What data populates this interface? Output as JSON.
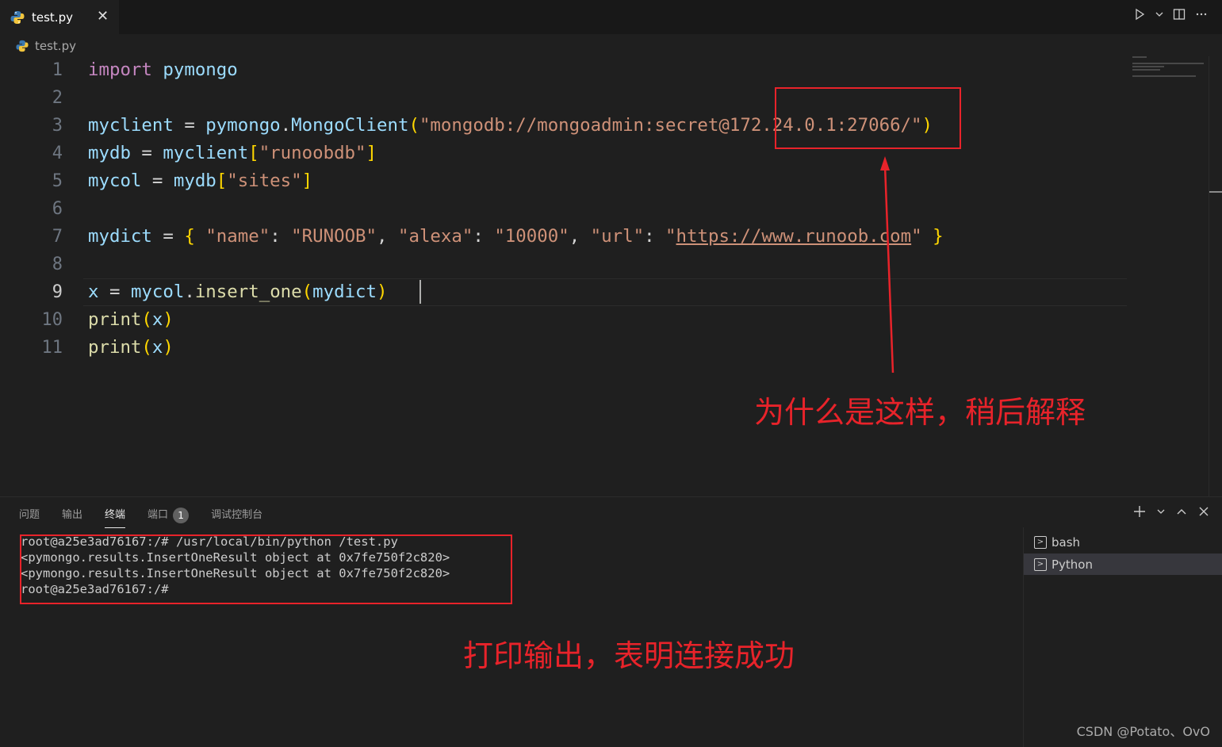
{
  "tab": {
    "label": "test.py",
    "close": "✕"
  },
  "breadcrumb": {
    "file": "test.py"
  },
  "editor": {
    "line_numbers": [
      "1",
      "2",
      "3",
      "4",
      "5",
      "6",
      "7",
      "8",
      "9",
      "10",
      "11"
    ],
    "lines": {
      "l1_kw": "import",
      "l1_mod": "pymongo",
      "l3_var": "myclient",
      "l3_eq": " = ",
      "l3_mod": "pymongo",
      "l3_dot": ".",
      "l3_fn": "MongoClient",
      "l3_open": "(",
      "l3_str": "\"mongodb://mongoadmin:secret@172.24.0.1:27066/\"",
      "l3_close": ")",
      "l4_var": "mydb",
      "l4_eq": " = ",
      "l4_obj": "myclient",
      "l4_open": "[",
      "l4_str": "\"runoobdb\"",
      "l4_close": "]",
      "l5_var": "mycol",
      "l5_eq": " = ",
      "l5_obj": "mydb",
      "l5_open": "[",
      "l5_str": "\"sites\"",
      "l5_close": "]",
      "l7_var": "mydict",
      "l7_eq": " = ",
      "l7_open": "{",
      "l7_k1": "\"name\"",
      "l7_c1": ": ",
      "l7_v1": "\"RUNOOB\"",
      "l7_s1": ", ",
      "l7_k2": "\"alexa\"",
      "l7_c2": ": ",
      "l7_v2": "\"10000\"",
      "l7_s2": ", ",
      "l7_k3": "\"url\"",
      "l7_c3": ": ",
      "l7_q1": "\"",
      "l7_url": "https://www.runoob.com",
      "l7_q2": "\"",
      "l7_close": "}",
      "l9_var": "x",
      "l9_eq": " = ",
      "l9_obj": "mycol",
      "l9_dot": ".",
      "l9_fn": "insert_one",
      "l9_open": "(",
      "l9_arg": "mydict",
      "l9_close": ")",
      "l10_fn": "print",
      "l10_open": "(",
      "l10_arg": "x",
      "l10_close": ")",
      "l11_fn": "print",
      "l11_open": "(",
      "l11_arg": "x",
      "l11_close": ")"
    }
  },
  "annotations": {
    "editor_note": "为什么是这样，稍后解释",
    "terminal_note": "打印输出，表明连接成功",
    "color": "#e8232a"
  },
  "panel": {
    "tabs": [
      "问题",
      "输出",
      "终端",
      "端口",
      "调试控制台"
    ],
    "ports_badge": "1",
    "terminal_lines": [
      "root@a25e3ad76167:/# /usr/local/bin/python /test.py",
      "<pymongo.results.InsertOneResult object at 0x7fe750f2c820>",
      "<pymongo.results.InsertOneResult object at 0x7fe750f2c820>",
      "root@a25e3ad76167:/#"
    ],
    "terminals": [
      "bash",
      "Python"
    ],
    "selected_terminal": "Python"
  },
  "watermark": "CSDN @Potato、OvO"
}
